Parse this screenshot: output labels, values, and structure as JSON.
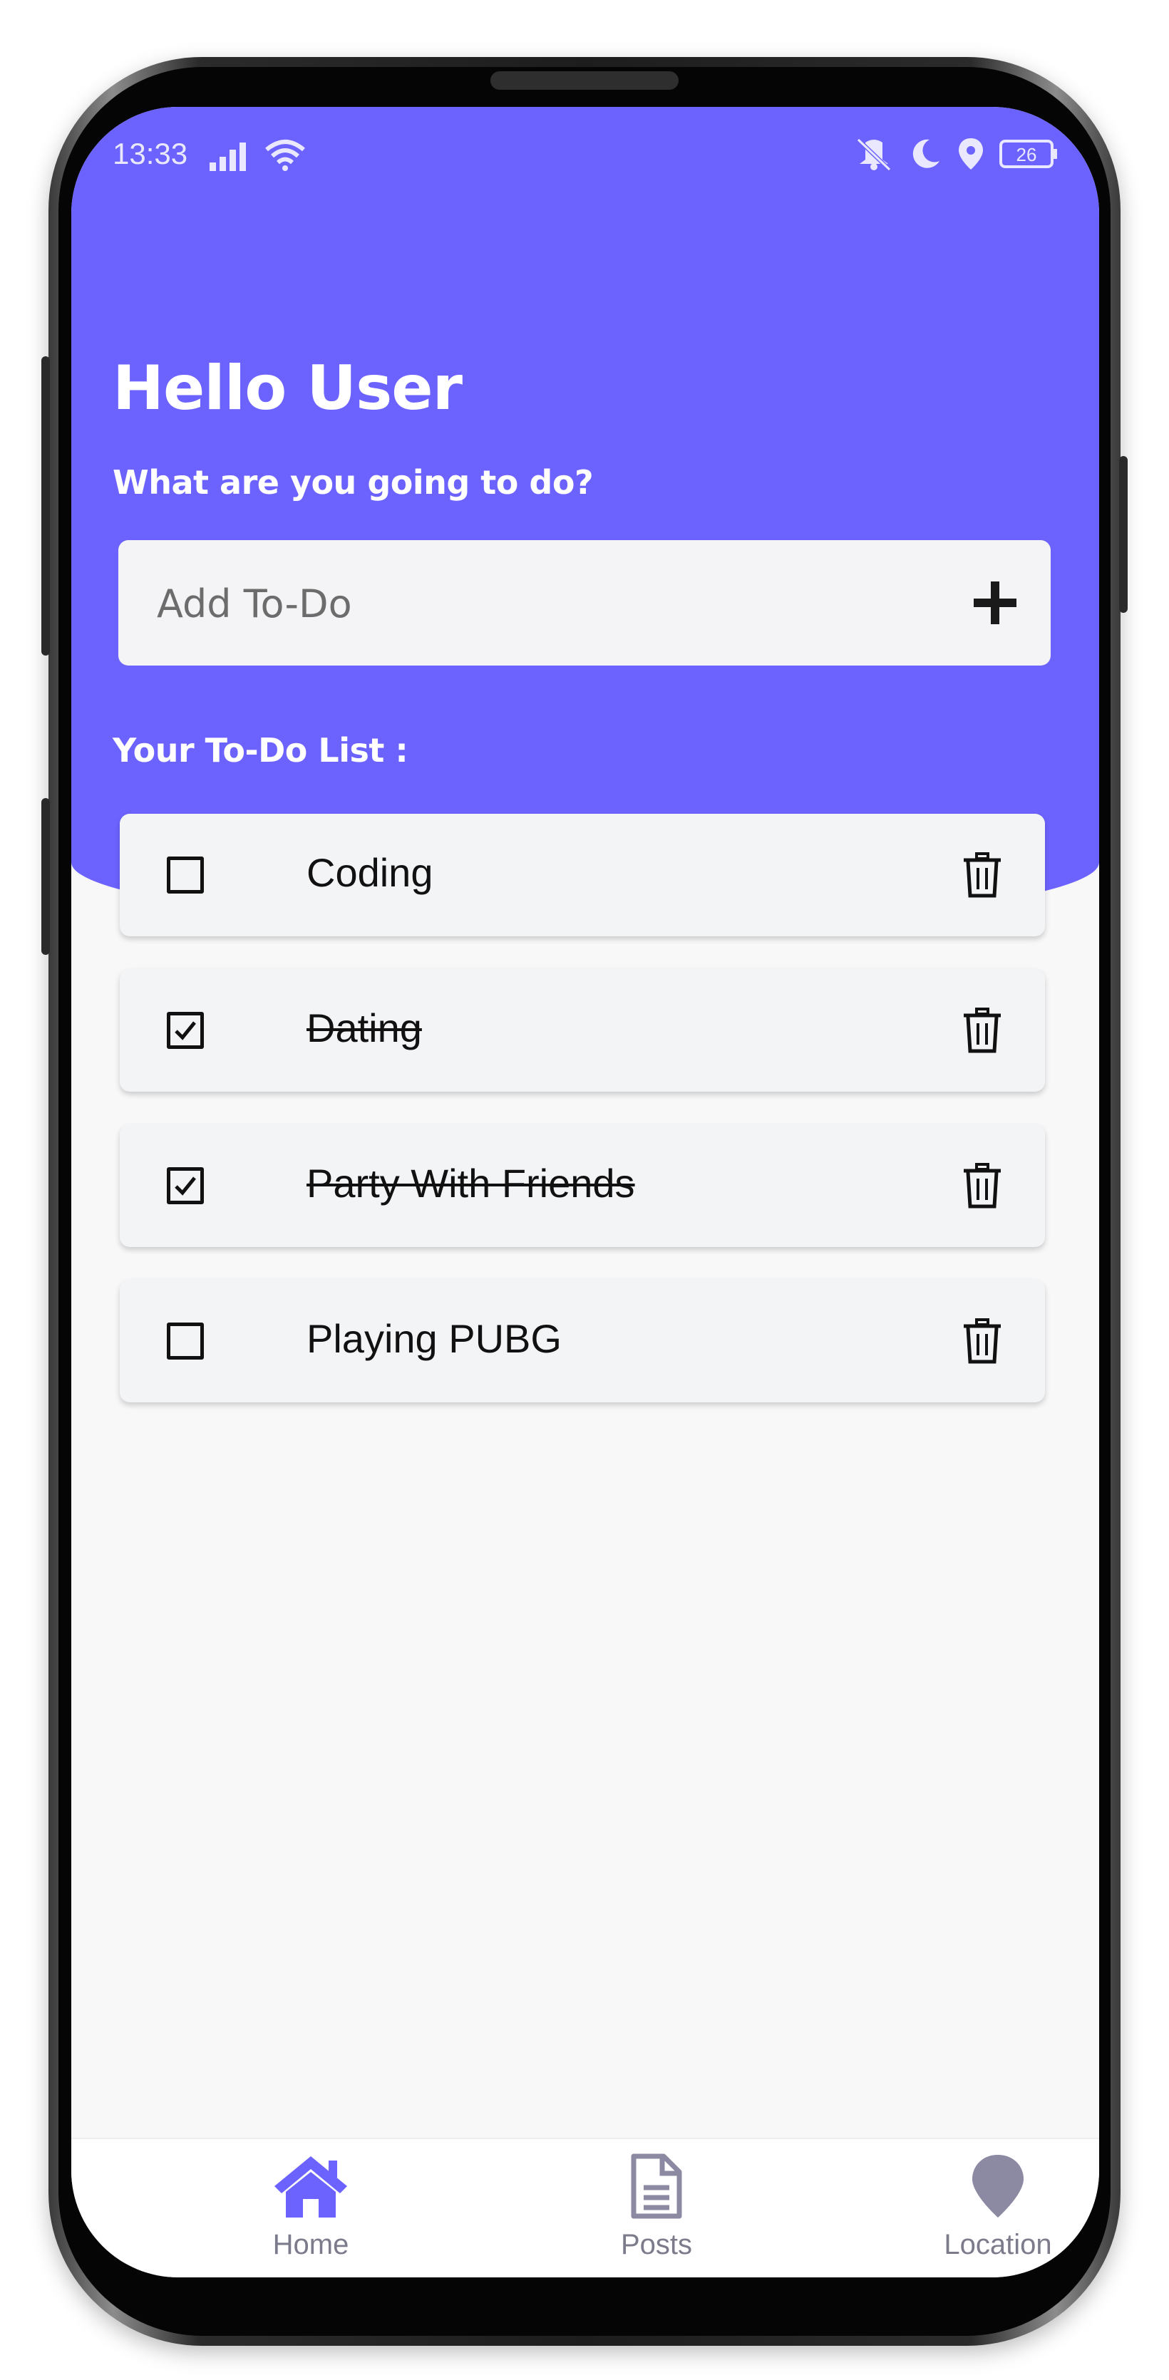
{
  "status_bar": {
    "time": "13:33",
    "battery": "26",
    "icons": [
      "signal-icon",
      "wifi-icon",
      "vibrate-off-icon",
      "moon-icon",
      "location-pin-icon",
      "battery-icon"
    ]
  },
  "colors": {
    "accent": "#6c63ff",
    "card": "#f3f4f6",
    "background": "#f8f8f9"
  },
  "header": {
    "title": "Hello User",
    "subtitle": "What are you going to do?"
  },
  "add_todo": {
    "placeholder": "Add To-Do",
    "button_icon": "plus-icon"
  },
  "list": {
    "heading": "Your To-Do List :",
    "items": [
      {
        "text": "Coding",
        "done": false
      },
      {
        "text": "Dating",
        "done": true
      },
      {
        "text": "Party With Friends",
        "done": true
      },
      {
        "text": "Playing PUBG",
        "done": false
      }
    ]
  },
  "nav": {
    "items": [
      {
        "label": "Home",
        "icon": "home-icon",
        "active": true
      },
      {
        "label": "Posts",
        "icon": "document-icon",
        "active": false
      },
      {
        "label": "Location",
        "icon": "map-pin-icon",
        "active": false
      }
    ]
  }
}
